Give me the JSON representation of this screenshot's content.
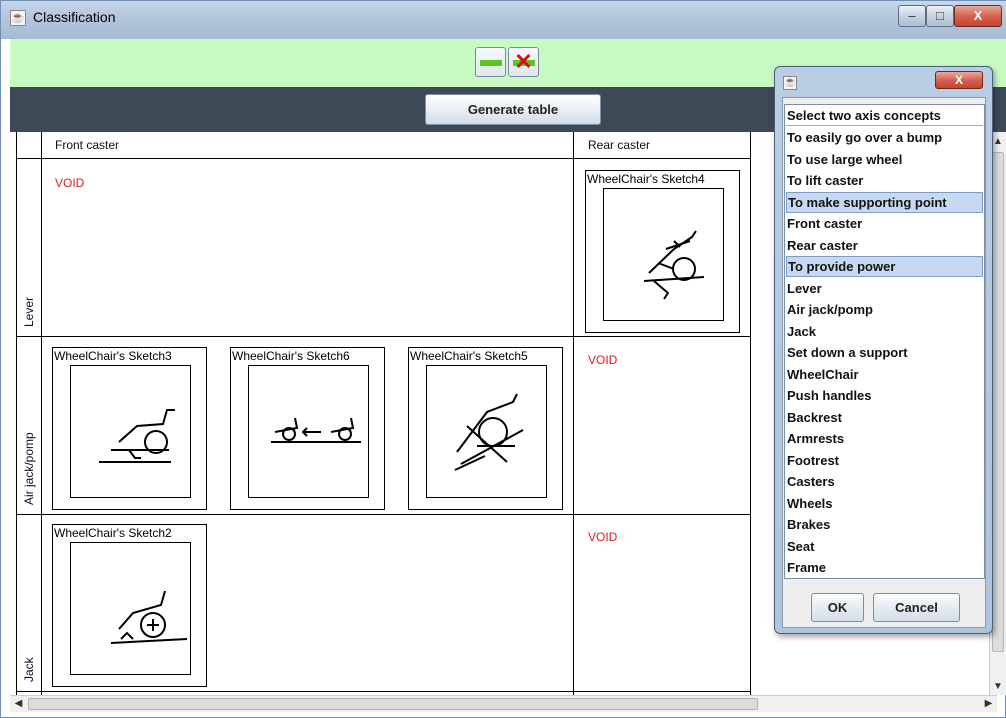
{
  "window": {
    "title": "Classification",
    "icon": "java-cup-icon",
    "controls": {
      "minimize": "‒",
      "maximize": "□",
      "close": "X"
    }
  },
  "toolbar": {
    "minus_icon": "green-bar-icon",
    "remove_icon": "red-x-icon",
    "generate_label": "Generate table"
  },
  "table": {
    "columns": [
      "Front caster",
      "Rear caster"
    ],
    "rows": [
      "Lever",
      "Air jack/pomp",
      "Jack"
    ],
    "void_label": "VOID",
    "sketches": {
      "s4": "WheelChair's Sketch4",
      "s3": "WheelChair's Sketch3",
      "s6": "WheelChair's Sketch6",
      "s5": "WheelChair's Sketch5",
      "s2": "WheelChair's Sketch2"
    }
  },
  "dialog": {
    "close": "X",
    "list_header": "Select two axis concepts",
    "items": [
      "To easily go over a bump",
      "To use large wheel",
      "To lift caster",
      "To make supporting point",
      "Front caster",
      "Rear caster",
      "To provide power",
      "Lever",
      "Air jack/pomp",
      "Jack",
      "Set down a support",
      "WheelChair",
      "Push handles",
      "Backrest",
      "Armrests",
      "Footrest",
      "Casters",
      "Wheels",
      "Brakes",
      "Seat",
      "Frame"
    ],
    "selected_items": [
      "To make supporting point",
      "To provide power"
    ],
    "ok_label": "OK",
    "cancel_label": "Cancel"
  },
  "scroll": {
    "left": "◀",
    "right": "▶",
    "up": "▲",
    "down": "▼"
  }
}
